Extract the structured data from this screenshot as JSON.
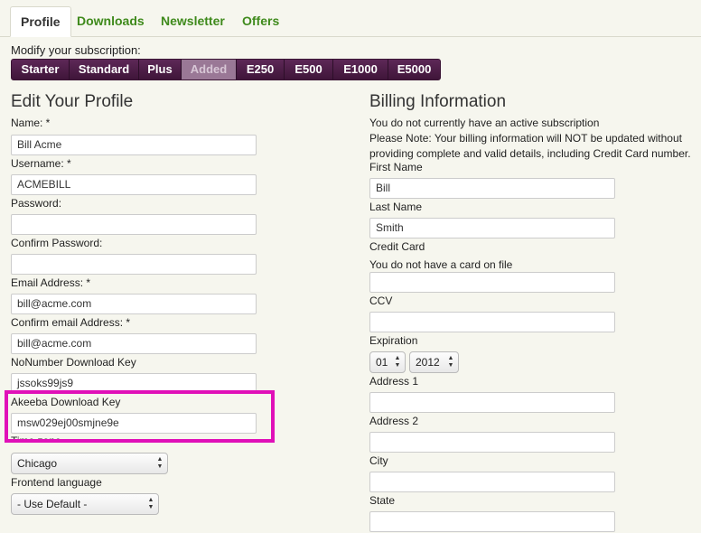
{
  "tabs": [
    {
      "label": "Profile",
      "active": true
    },
    {
      "label": "Downloads",
      "active": false
    },
    {
      "label": "Newsletter",
      "active": false
    },
    {
      "label": "Offers",
      "active": false
    }
  ],
  "subscription": {
    "label": "Modify your subscription:",
    "plans": [
      "Starter",
      "Standard",
      "Plus",
      "Added",
      "E250",
      "E500",
      "E1000",
      "E5000"
    ],
    "selected": "Added"
  },
  "profile": {
    "heading": "Edit Your Profile",
    "name_label": "Name: *",
    "name_value": "Bill Acme",
    "username_label": "Username: *",
    "username_value": "ACMEBILL",
    "password_label": "Password:",
    "confirm_password_label": "Confirm Password:",
    "email_label": "Email Address: *",
    "email_value": "bill@acme.com",
    "confirm_email_label": "Confirm email Address: *",
    "confirm_email_value": "bill@acme.com",
    "nonumber_label": "NoNumber Download Key",
    "nonumber_value": "jssoks99js9",
    "akeeba_label": "Akeeba Download Key",
    "akeeba_value": "msw029ej00smjne9e",
    "timezone_label": "Time zone",
    "timezone_value": "Chicago",
    "language_label": "Frontend language",
    "language_value": "- Use Default -"
  },
  "billing": {
    "heading": "Billing Information",
    "note_line1": "You do not currently have an active subscription",
    "note_line2": "Please Note: Your billing information will NOT be updated without",
    "note_line3": "providing complete and valid details, including Credit Card number.",
    "first_name_label": "First Name",
    "first_name_value": "Bill",
    "last_name_label": "Last Name",
    "last_name_value": "Smith",
    "credit_card_label": "Credit Card",
    "card_status": "You do not have a card on file",
    "ccv_label": "CCV",
    "expiration_label": "Expiration",
    "exp_month": "01",
    "exp_year": "2012",
    "address1_label": "Address 1",
    "address2_label": "Address 2",
    "city_label": "City",
    "state_label": "State"
  },
  "colors": {
    "tab_green": "#3f8a1c",
    "plan_purple": "#4e1f48",
    "highlight_magenta": "#e010b8",
    "background": "#f6f6ee"
  }
}
